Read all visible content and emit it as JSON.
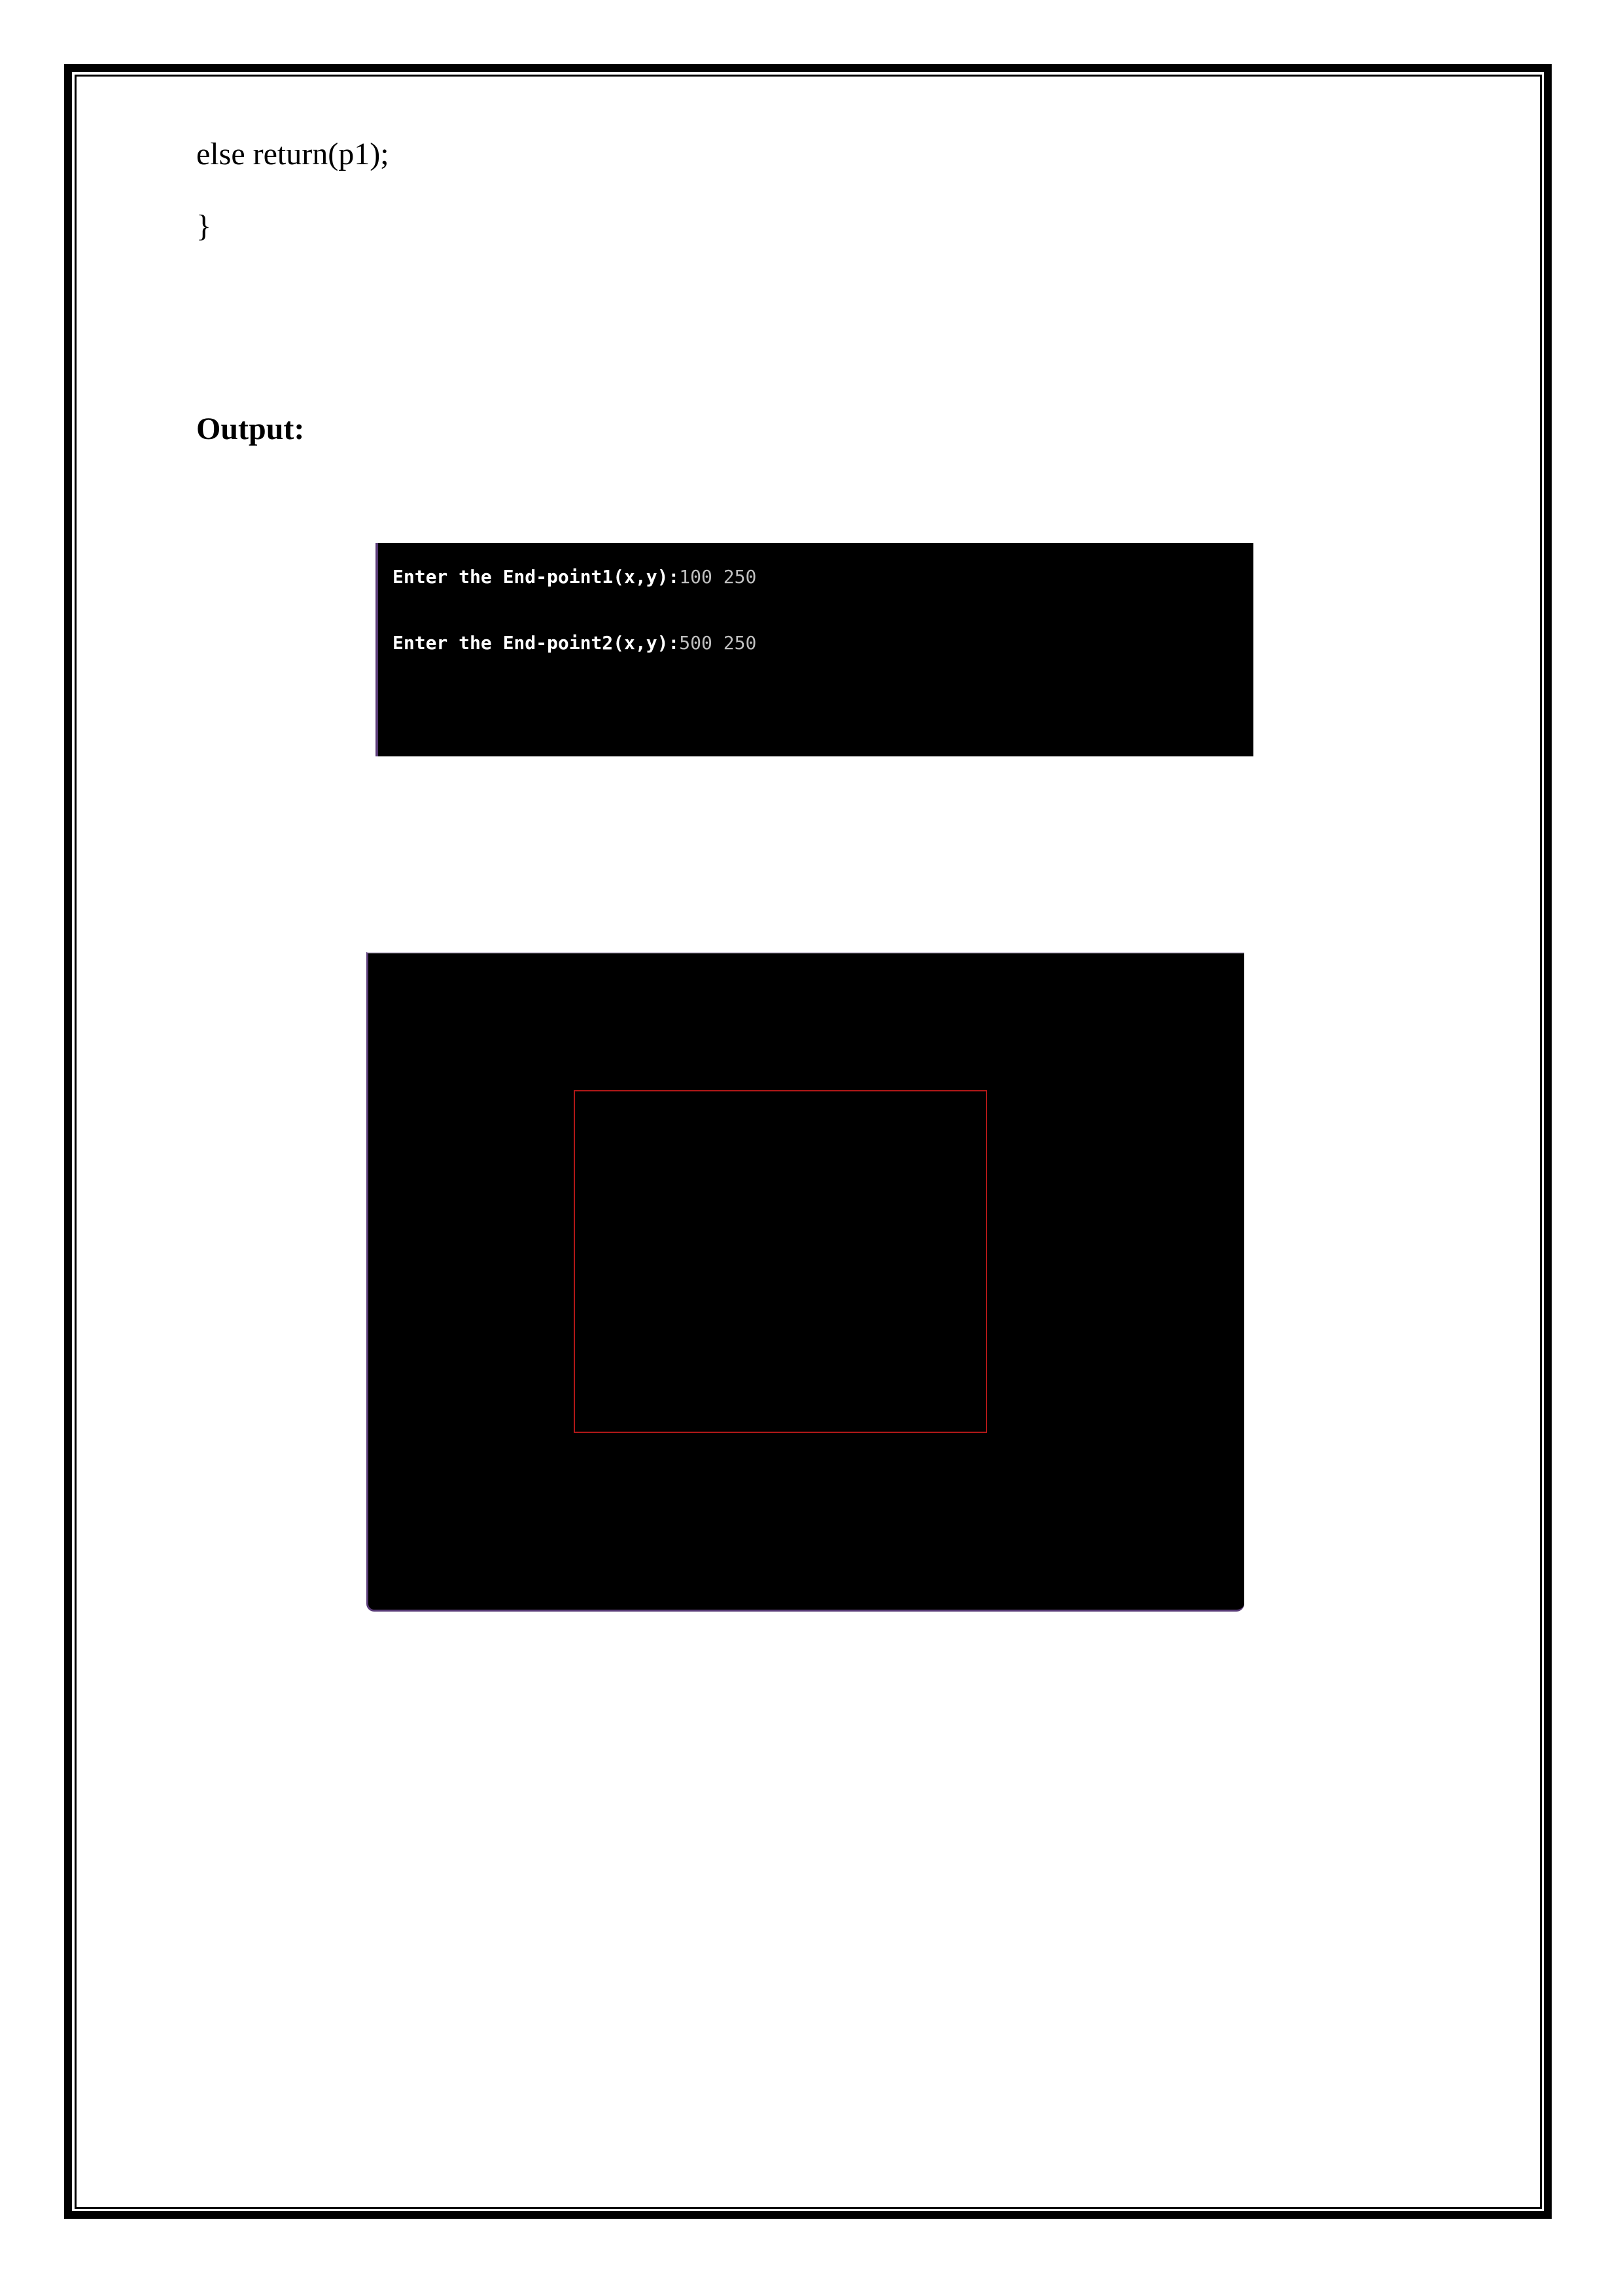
{
  "code": {
    "line1": "else return(p1);",
    "line2": "}"
  },
  "output_heading": "Output:",
  "console": {
    "lines": [
      {
        "prompt": "Enter the End-point1(x,y):",
        "value": "100 250"
      },
      {
        "prompt": "Enter the End-point2(x,y):",
        "value": "500 250"
      }
    ]
  },
  "graphics": {
    "clip_window_color": "#b01818",
    "background_color": "#000000"
  }
}
